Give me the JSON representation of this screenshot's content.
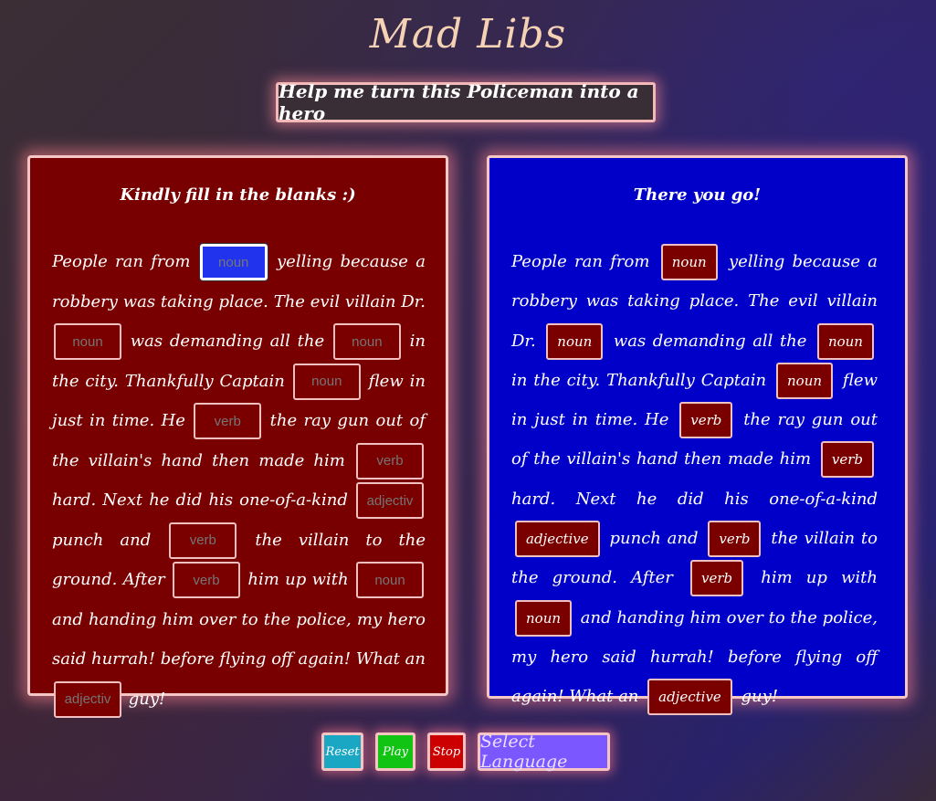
{
  "title": "Mad Libs",
  "subtitle": "Help me turn this Policeman into a hero",
  "left_panel": {
    "heading": "Kindly fill in the blanks :)",
    "placeholders": {
      "p1": "noun",
      "p2": "noun",
      "p3": "noun",
      "p4": "noun",
      "p5": "verb",
      "p6": "verb",
      "p7": "adjectiv",
      "p8": "verb",
      "p9": "verb",
      "p10": "noun",
      "p11": "adjectiv"
    }
  },
  "right_panel": {
    "heading": "There you go!",
    "words": {
      "w1": "noun",
      "w2": "noun",
      "w3": "noun",
      "w4": "noun",
      "w5": "verb",
      "w6": "verb",
      "w7": "adjective",
      "w8": "verb",
      "w9": "verb",
      "w10": "noun",
      "w11": "adjective"
    }
  },
  "story": {
    "t1": "People ran from",
    "t2": "yelling because a robbery was taking place. The evil villain Dr.",
    "t3": "was demanding all the",
    "t4": "in the city. Thankfully Captain",
    "t5": "flew in just in time. He",
    "t6": "the ray gun out of the villain's hand then made him",
    "t7": "hard. Next he did his one-of-a-kind",
    "t8": "punch and",
    "t9": "the villain to the ground. After",
    "t10": "him up with",
    "t11": "and handing him over to the police, my hero said hurrah! before flying off again! What an",
    "t12": "guy!"
  },
  "buttons": {
    "reset": "Reset",
    "play": "Play",
    "stop": "Stop",
    "language": "Select Language"
  }
}
